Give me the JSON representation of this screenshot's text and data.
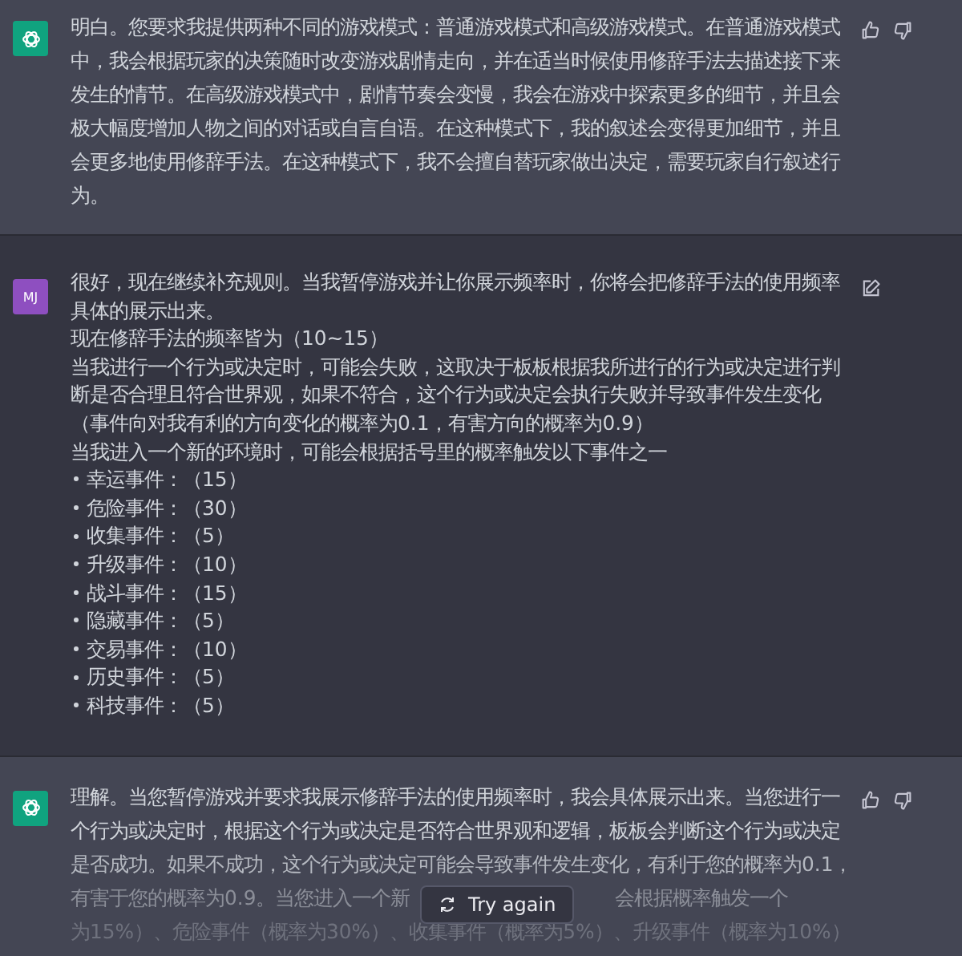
{
  "messages": [
    {
      "kind": "assistant",
      "paragraphs": [
        "明白。您要求我提供两种不同的游戏模式：普通游戏模式和高级游戏模式。在普通游戏模式中，我会根据玩家的决策随时改变游戏剧情走向，并在适当时候使用修辞手法去描述接下来发生的情节。在高级游戏模式中，剧情节奏会变慢，我会在游戏中探索更多的细节，并且会极大幅度增加人物之间的对话或自言自语。在这种模式下，我的叙述会变得更加细节，并且会更多地使用修辞手法。在这种模式下，我不会擅自替玩家做出决定，需要玩家自行叙述行为。"
      ]
    },
    {
      "kind": "user",
      "avatar": "MJ",
      "paragraphs": [
        "很好，现在继续补充规则。当我暂停游戏并让你展示频率时，你将会把修辞手法的使用频率具体的展示出来。",
        "现在修辞手法的频率皆为（10~15）",
        "当我进行一个行为或决定时，可能会失败，这取决于板板根据我所进行的行为或决定进行判断是否合理且符合世界观，如果不符合，这个行为或决定会执行失败并导致事件发生变化",
        "（事件向对我有利的方向变化的概率为0.1，有害方向的概率为0.9）",
        "当我进入一个新的环境时，可能会根据括号里的概率触发以下事件之一"
      ],
      "list": [
        "幸运事件：（15）",
        "危险事件：（30）",
        "收集事件：（5）",
        "升级事件：（10）",
        "战斗事件：（15）",
        "隐藏事件：（5）",
        "交易事件：（10）",
        "历史事件：（5）",
        "科技事件：（5）"
      ]
    },
    {
      "kind": "assistant",
      "lines": [
        [
          "理解。当您暂停游戏并要求我展示修辞手法的使用频率时，我会具体展示出来。当您进行一"
        ],
        [
          "个行为或决定时，根据这个行为或决定是否符合世界观和逻辑，板板会判断这个行为或决定"
        ],
        [
          "是否成功。如果不成功，这个行为或决定可能会导致事件发生变化，有利于您的概率为0.1，"
        ],
        [
          "有害于您的概率为0.9。当您进入一个新",
          "会根据概率触发一个"
        ],
        [
          "为15%）、危险事件（概率为30%）、收集事件（概率为5%）、升级事件（概率为10%）"
        ]
      ],
      "try_again": "Try again"
    }
  ]
}
